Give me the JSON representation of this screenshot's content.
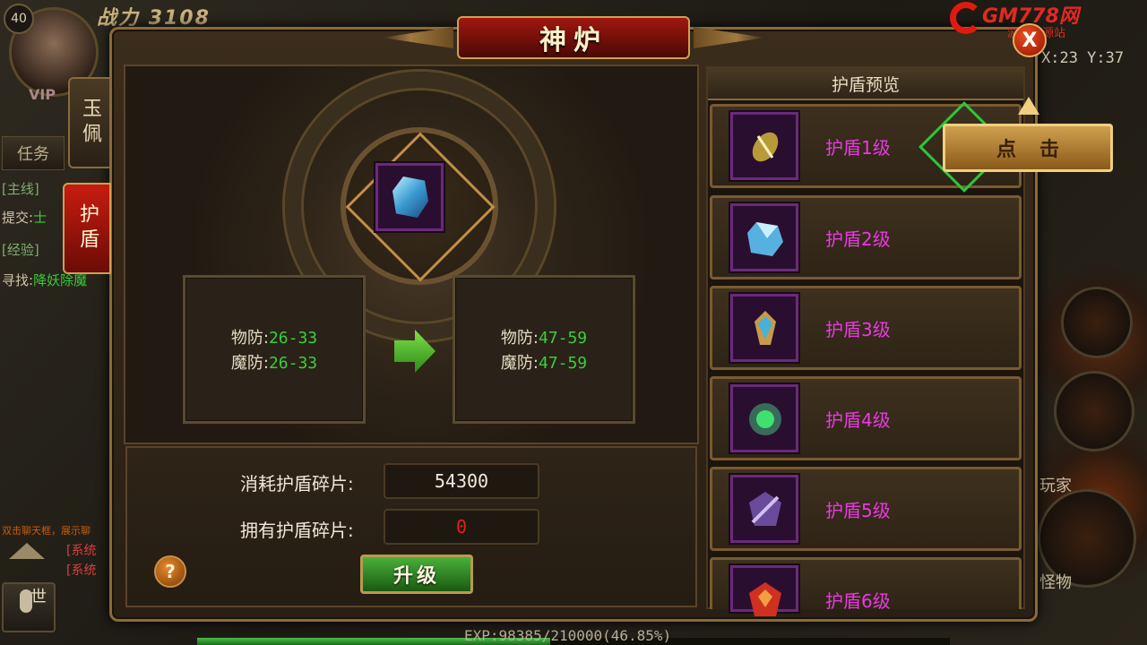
{
  "hud": {
    "level": "40",
    "power_label": "战力",
    "power_value": "3108",
    "vip": "VIP",
    "task_tab": "任务",
    "quest_main_tag": "[主线]",
    "quest_submit": "提交:",
    "quest_submit_target": "士",
    "quest_exp_tag": "[经验]",
    "quest_find": "寻找:",
    "quest_find_target": "降妖除魔",
    "chat_hint": "双击聊天框，展示聊",
    "sys_msg_1": "[系统",
    "sys_msg_2": "[系统",
    "world_label": "世",
    "exp_text": "EXP:98385/210000(46.85%)",
    "exp_fraction": 0.4685,
    "coords": "X:23 Y:37",
    "player_label": "玩家",
    "monster_label": "怪物"
  },
  "watermark": {
    "text": "GM778网",
    "sub": "游戏资源站"
  },
  "panel": {
    "title": "神炉",
    "close_label": "X",
    "tabs": [
      {
        "label": "玉佩"
      },
      {
        "label": "护盾"
      }
    ],
    "current_stats": {
      "phys_label": "物防:",
      "phys_value": "26-33",
      "magic_label": "魔防:",
      "magic_value": "26-33"
    },
    "next_stats": {
      "phys_label": "物防:",
      "phys_value": "47-59",
      "magic_label": "魔防:",
      "magic_value": "47-59"
    },
    "cost": {
      "need_label": "消耗护盾碎片:",
      "need_value": "54300",
      "have_label": "拥有护盾碎片:",
      "have_value": "0"
    },
    "help_label": "?",
    "upgrade_label": "升级"
  },
  "preview": {
    "header": "护盾预览",
    "click_label": "点击",
    "levels": [
      {
        "label": "护盾1级",
        "icon": "gold-shield-icon"
      },
      {
        "label": "护盾2级",
        "icon": "blue-crystal-shield-icon"
      },
      {
        "label": "护盾3级",
        "icon": "winged-shield-icon"
      },
      {
        "label": "护盾4级",
        "icon": "green-orb-shield-icon"
      },
      {
        "label": "护盾5级",
        "icon": "purple-shield-icon"
      },
      {
        "label": "护盾6级",
        "icon": "red-shield-icon"
      }
    ]
  },
  "colors": {
    "stat_value": "#3acf3a",
    "level_label": "#e83ae0",
    "have_value": "#e02020"
  }
}
